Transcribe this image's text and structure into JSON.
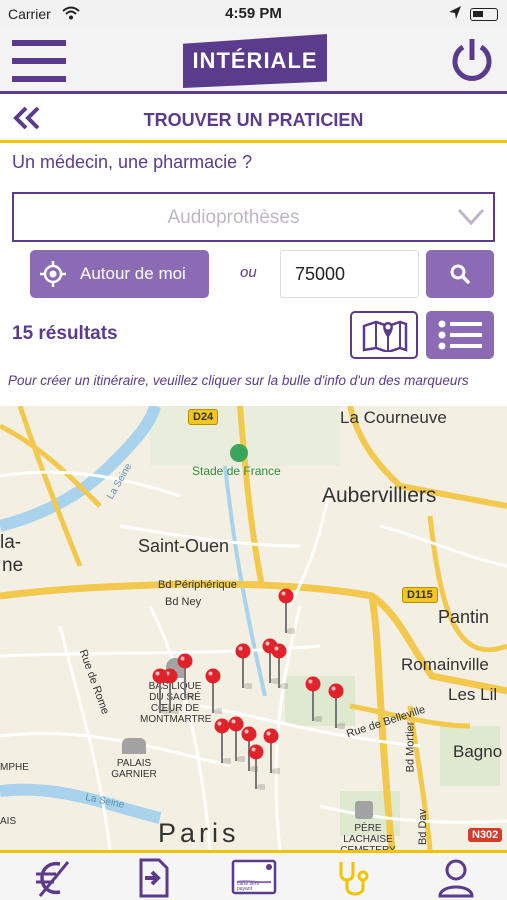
{
  "status_bar": {
    "carrier": "Carrier",
    "time": "4:59 PM"
  },
  "header": {
    "logo_text": "INTÉRIALE"
  },
  "page": {
    "title": "TROUVER UN PRATICIEN"
  },
  "search": {
    "question": "Un médecin, une pharmacie ?",
    "specialty_selected": "Audioprothèses",
    "around_me_label": "Autour de moi",
    "or_label": "ou",
    "postal_code_value": "75000"
  },
  "results": {
    "count_label": "15 résultats",
    "hint": "Pour créer un itinéraire, veuillez cliquer sur la bulle d'info d'un des marqueurs"
  },
  "map": {
    "road_badges": [
      "D24",
      "D115",
      "N302"
    ],
    "places": {
      "la_courneuve": "La Courneuve",
      "stade": "Stade de France",
      "aubervilliers": "Aubervilliers",
      "saint_ouen": "Saint-Ouen",
      "la_seine_top": "La Seine",
      "bd_peripherique": "Bd Périphérique",
      "bd_ney": "Bd Ney",
      "pantin": "Pantin",
      "romainville": "Romainville",
      "les_lilas": "Les Lil",
      "bagnolet": "Bagno",
      "rue_de_belleville": "Rue de Belleville",
      "bd_mortier": "Bd Mortier",
      "bd_davout": "Bd Dav",
      "rue_de_rome": "Rue de Rome",
      "basilique": "BASILIQUE DU SACRÉ CŒUR DE MONTMARTRE",
      "palais_garnier": "PALAIS GARNIER",
      "la_seine_bottom": "La Seine",
      "pere_lachaise": "PÈRE LACHAISE CEMETERY",
      "paris": "Paris",
      "left_la": "la-",
      "left_ne": "ne",
      "left_mphe": "MPHE",
      "left_ais": "AIS"
    },
    "marker_count": 15,
    "marker_color": "#e0232a"
  },
  "bottom_nav": [
    "euro-tab",
    "document-tab",
    "tiers-payant-card-tab",
    "stethoscope-tab",
    "profile-tab"
  ],
  "card_text": "carte tiers payant",
  "colors": {
    "brand_purple": "#5b3b8c",
    "button_purple": "#8c6bb5",
    "accent_yellow": "#f0c400",
    "map_background": "#f4efe3"
  }
}
